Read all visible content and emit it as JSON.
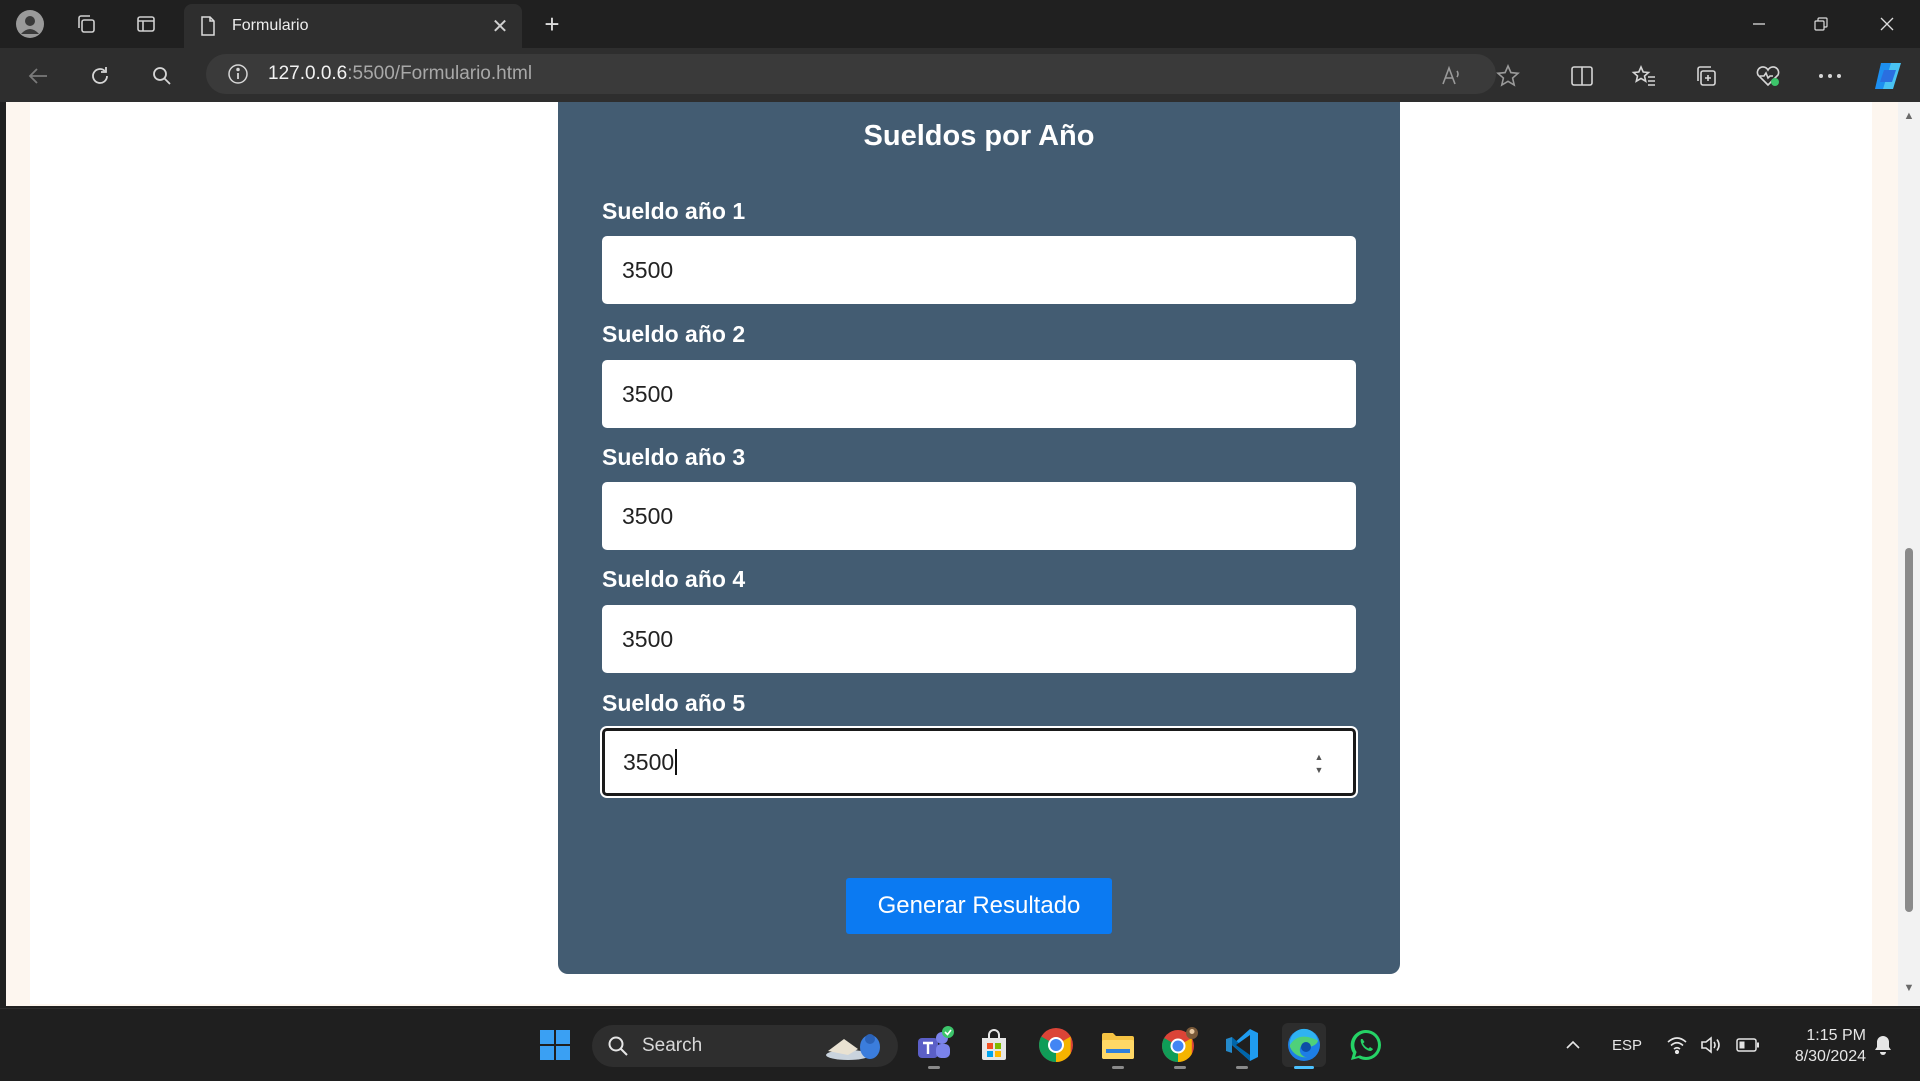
{
  "browser": {
    "tab_title": "Formulario",
    "url_host": "127.0.0.6",
    "url_path": ":5500/Formulario.html"
  },
  "form": {
    "title": "Sueldos por Año",
    "fields": [
      {
        "label": "Sueldo año 1",
        "value": "3500"
      },
      {
        "label": "Sueldo año 2",
        "value": "3500"
      },
      {
        "label": "Sueldo año 3",
        "value": "3500"
      },
      {
        "label": "Sueldo año 4",
        "value": "3500"
      },
      {
        "label": "Sueldo año 5",
        "value": "3500"
      }
    ],
    "submit_label": "Generar Resultado"
  },
  "taskbar": {
    "search_label": "Search",
    "language": "ESP",
    "time": "1:15 PM",
    "date": "8/30/2024"
  },
  "colors": {
    "card_bg": "#435c72",
    "button_bg": "#0b7af2",
    "page_bg": "#ffffff"
  }
}
